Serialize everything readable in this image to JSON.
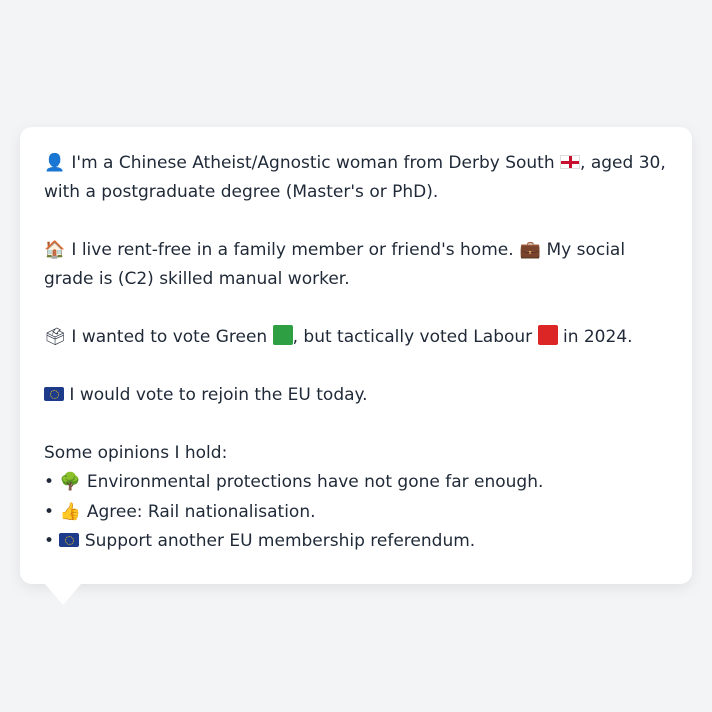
{
  "profile": {
    "identity": {
      "icon": "person-silhouette-icon",
      "text_before_flag": "I'm a Chinese Atheist/Agnostic woman from Derby South",
      "flag_icon": "england-flag-icon",
      "text_after_flag": ", aged 30, with a postgraduate degree (Master's or PhD)."
    },
    "housing": {
      "icon": "house-icon",
      "text": "I live rent-free in a family member or friend's home.",
      "grade_icon": "briefcase-icon",
      "grade_text": "My social grade is (C2) skilled manual worker."
    },
    "vote": {
      "icon": "ballot-box-icon",
      "text_1": "I wanted to vote Green",
      "green_color": "#2ea043",
      "text_2": ", but tactically voted Labour",
      "red_color": "#dc2626",
      "text_3": " in 2024."
    },
    "eu": {
      "icon": "eu-flag-icon",
      "text": "I would vote to rejoin the EU today."
    },
    "opinions_heading": "Some opinions I hold:",
    "opinions": [
      {
        "icon": "tree-icon",
        "text": "Environmental protections have not gone far enough."
      },
      {
        "icon": "thumbs-up-icon",
        "text": "Agree: Rail nationalisation."
      },
      {
        "icon": "eu-flag-icon",
        "text": "Support another EU membership referendum."
      }
    ]
  }
}
